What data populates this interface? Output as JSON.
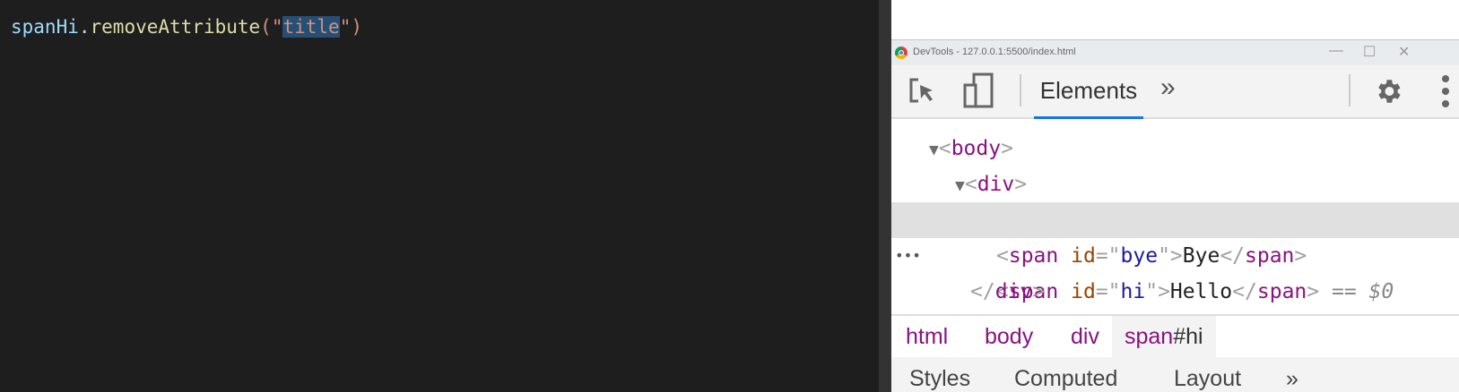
{
  "editor": {
    "code": {
      "object": "spanHi",
      "dot": ".",
      "method": "removeAttribute",
      "open": "(\"",
      "selected": "title",
      "close": "\")"
    },
    "colors": {
      "background": "#1e1e1e",
      "variable": "#9cdcfe",
      "function": "#dcdcaa",
      "string": "#ce9178",
      "selection": "#264f78"
    }
  },
  "devtools": {
    "window_title": "DevTools - 127.0.0.1:5500/index.html",
    "window_controls": {
      "minimize": "—",
      "maximize": "☐",
      "close": "✕"
    },
    "toolbar": {
      "inspect_icon": "inspect-element-icon",
      "device_icon": "device-toggle-icon",
      "active_tab": "Elements",
      "more_tabs": "»",
      "settings_icon": "gear-icon",
      "menu_icon": "kebab-menu-icon"
    },
    "accent": "#1a73e8",
    "tree": {
      "body": {
        "open": "<",
        "tag": "body",
        "close": ">"
      },
      "div": {
        "open": "<",
        "tag": "div",
        "close": ">"
      },
      "span_hi": {
        "ellipsis": "•••",
        "tag": "span",
        "attr": "id",
        "value": "hi",
        "text": "Hello",
        "marker": "== $0"
      },
      "span_bye": {
        "tag": "span",
        "attr": "id",
        "value": "bye",
        "text": "Bye"
      },
      "div_close": {
        "tag": "div"
      }
    },
    "breadcrumbs": [
      {
        "label": "html"
      },
      {
        "label": "body"
      },
      {
        "label": "div"
      },
      {
        "label": "span",
        "suffix": "#hi"
      }
    ],
    "lower_tabs": [
      "Styles",
      "Computed",
      "Layout",
      "»"
    ]
  }
}
